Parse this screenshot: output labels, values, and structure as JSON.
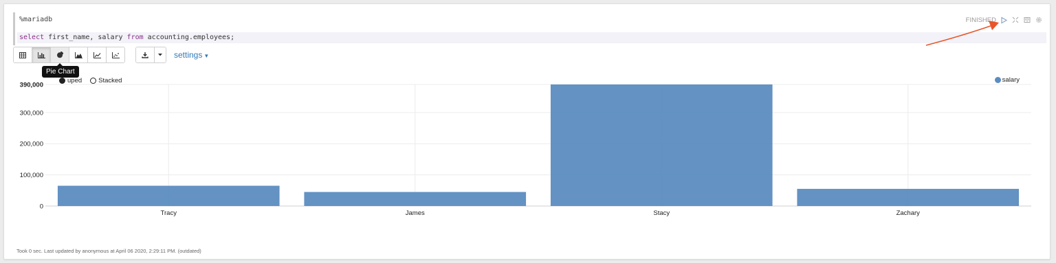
{
  "paragraph": {
    "interpreter": "%mariadb",
    "code": {
      "kw1": "select",
      "mid": " first_name, salary ",
      "kw2": "from",
      "tail": " accounting.employees;"
    },
    "status": "FINISHED"
  },
  "toolbar": {
    "buttons": [
      {
        "name": "table",
        "icon": "table-icon"
      },
      {
        "name": "bar-chart",
        "icon": "bar-chart-icon",
        "active": true
      },
      {
        "name": "pie-chart",
        "icon": "pie-chart-icon",
        "hover": true
      },
      {
        "name": "area-chart",
        "icon": "area-chart-icon"
      },
      {
        "name": "line-chart",
        "icon": "line-chart-icon"
      },
      {
        "name": "scatter-chart",
        "icon": "scatter-chart-icon"
      }
    ],
    "settings_label": "settings",
    "tooltip": "Pie Chart"
  },
  "chart_controls": {
    "grouped_label": "Grouped",
    "grouped_visible": "uped",
    "stacked_label": "Stacked",
    "selected": "Grouped"
  },
  "chart_data": {
    "type": "bar",
    "categories": [
      "Tracy",
      "James",
      "Stacy",
      "Zachary"
    ],
    "series": [
      {
        "name": "salary",
        "values": [
          65000,
          45000,
          390000,
          55000
        ],
        "color": "#5b8cc0"
      }
    ],
    "yticks": [
      0,
      100000,
      200000,
      300000,
      390000
    ],
    "ytick_labels": [
      "0",
      "100,000",
      "200,000",
      "300,000",
      "390,000"
    ],
    "ylim": [
      0,
      390000
    ],
    "grid": true,
    "legend": "top-right"
  },
  "footer": "Took 0 sec. Last updated by anonymous at April 06 2020, 2:29:11 PM. (outdated)",
  "colors": {
    "accent_link": "#337ab7",
    "bar": "#5b8cc0",
    "annotation_arrow": "#e8562a"
  }
}
